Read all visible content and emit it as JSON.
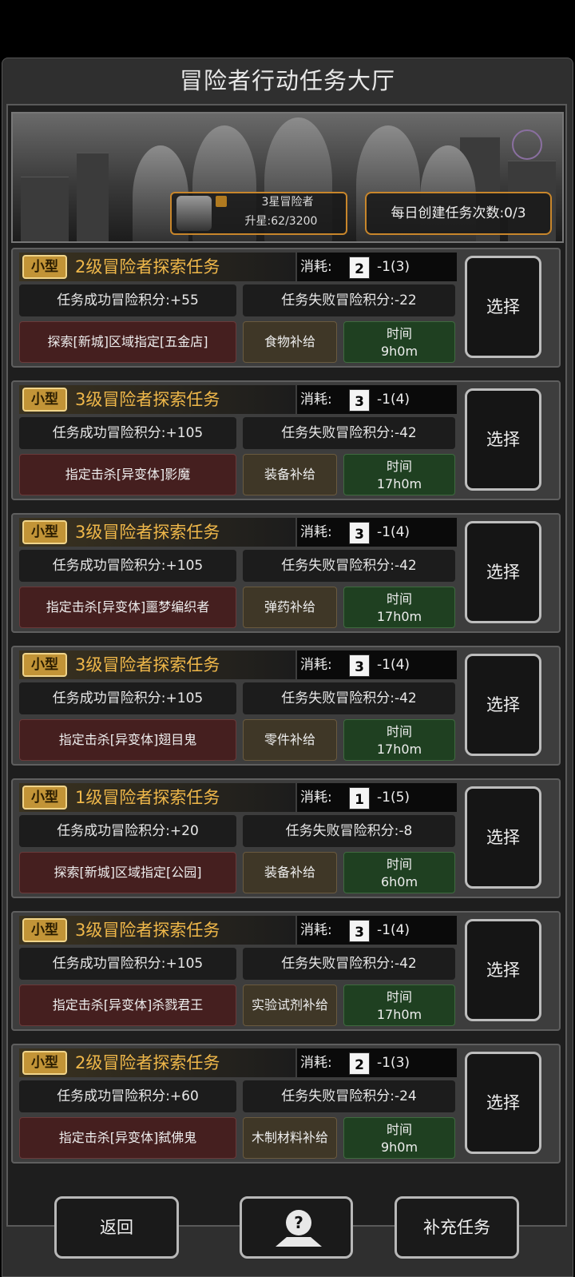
{
  "window": {
    "title": "冒险者行动任务大厅"
  },
  "banner": {
    "rank_label": "3星冒险者",
    "star_progress": "升星:62/3200",
    "daily_create": "每日创建任务次数:0/3"
  },
  "quests": [
    {
      "tag": "小型",
      "title": "2级冒险者探索任务",
      "cost_label": "消耗:",
      "card_level": "2",
      "cost_value": "-1(3)",
      "success": "任务成功冒险积分:+55",
      "fail": "任务失败冒险积分:-22",
      "target": "探索[新城]区域指定[五金店]",
      "supply": "食物补给",
      "time_label": "时间",
      "time_value": "9h0m",
      "select": "选择"
    },
    {
      "tag": "小型",
      "title": "3级冒险者探索任务",
      "cost_label": "消耗:",
      "card_level": "3",
      "cost_value": "-1(4)",
      "success": "任务成功冒险积分:+105",
      "fail": "任务失败冒险积分:-42",
      "target": "指定击杀[异变体]影魔",
      "supply": "装备补给",
      "time_label": "时间",
      "time_value": "17h0m",
      "select": "选择"
    },
    {
      "tag": "小型",
      "title": "3级冒险者探索任务",
      "cost_label": "消耗:",
      "card_level": "3",
      "cost_value": "-1(4)",
      "success": "任务成功冒险积分:+105",
      "fail": "任务失败冒险积分:-42",
      "target": "指定击杀[异变体]噩梦编织者",
      "supply": "弹药补给",
      "time_label": "时间",
      "time_value": "17h0m",
      "select": "选择"
    },
    {
      "tag": "小型",
      "title": "3级冒险者探索任务",
      "cost_label": "消耗:",
      "card_level": "3",
      "cost_value": "-1(4)",
      "success": "任务成功冒险积分:+105",
      "fail": "任务失败冒险积分:-42",
      "target": "指定击杀[异变体]翅目鬼",
      "supply": "零件补给",
      "time_label": "时间",
      "time_value": "17h0m",
      "select": "选择"
    },
    {
      "tag": "小型",
      "title": "1级冒险者探索任务",
      "cost_label": "消耗:",
      "card_level": "1",
      "cost_value": "-1(5)",
      "success": "任务成功冒险积分:+20",
      "fail": "任务失败冒险积分:-8",
      "target": "探索[新城]区域指定[公园]",
      "supply": "装备补给",
      "time_label": "时间",
      "time_value": "6h0m",
      "select": "选择"
    },
    {
      "tag": "小型",
      "title": "3级冒险者探索任务",
      "cost_label": "消耗:",
      "card_level": "3",
      "cost_value": "-1(4)",
      "success": "任务成功冒险积分:+105",
      "fail": "任务失败冒险积分:-42",
      "target": "指定击杀[异变体]杀戮君王",
      "supply": "实验试剂补给",
      "time_label": "时间",
      "time_value": "17h0m",
      "select": "选择"
    },
    {
      "tag": "小型",
      "title": "2级冒险者探索任务",
      "cost_label": "消耗:",
      "card_level": "2",
      "cost_value": "-1(3)",
      "success": "任务成功冒险积分:+60",
      "fail": "任务失败冒险积分:-24",
      "target": "指定击杀[异变体]弑佛鬼",
      "supply": "木制材料补给",
      "time_label": "时间",
      "time_value": "9h0m",
      "select": "选择"
    }
  ],
  "footer": {
    "back_label": "返回",
    "help_icon": "question-map-icon",
    "refill_label": "补充任务"
  },
  "colors": {
    "accent_gold": "#f0b84a",
    "target_bg": "#451f1f",
    "supply_bg": "#3f3727",
    "time_bg": "#1f4021"
  }
}
